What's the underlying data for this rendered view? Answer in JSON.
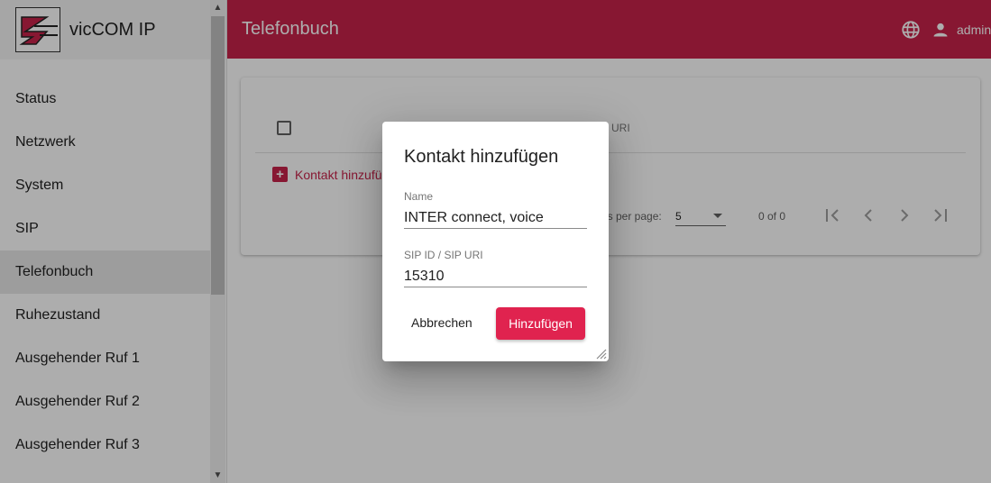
{
  "app": {
    "brand": "vicCOM IP",
    "page_title": "Telefonbuch",
    "user": "admin"
  },
  "sidebar": {
    "items": [
      {
        "label": "Status"
      },
      {
        "label": "Netzwerk"
      },
      {
        "label": "System"
      },
      {
        "label": "SIP"
      },
      {
        "label": "Telefonbuch",
        "active": true
      },
      {
        "label": "Ruhezustand"
      },
      {
        "label": "Ausgehender Ruf 1"
      },
      {
        "label": "Ausgehender Ruf 2"
      },
      {
        "label": "Ausgehender Ruf 3"
      }
    ]
  },
  "table": {
    "column_uri": "URI",
    "add_contact": "Kontakt hinzufügen",
    "rows_per_page_label": "ns per page:",
    "rows_per_page_value": "5",
    "range": "0 of 0"
  },
  "dialog": {
    "title": "Kontakt hinzufügen",
    "name_label": "Name",
    "name_value": "INTER connect, voice",
    "sip_label": "SIP ID / SIP URI",
    "sip_value": "15310",
    "cancel_label": "Abbrechen",
    "submit_label": "Hinzufügen"
  },
  "colors": {
    "primary": "#c8234a",
    "button": "#e0234f"
  },
  "icons": [
    "language-icon",
    "user-icon",
    "add-box-icon",
    "first-page-icon",
    "prev-page-icon",
    "next-page-icon",
    "last-page-icon",
    "resize-handle-icon",
    "dropdown-caret-icon"
  ]
}
